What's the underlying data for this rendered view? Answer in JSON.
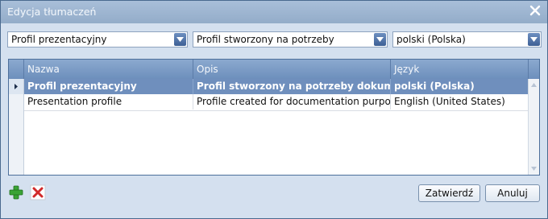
{
  "window": {
    "title": "Edycja tłumaczeń"
  },
  "filters": [
    {
      "value": "Profil prezentacyjny"
    },
    {
      "value": "Profil stworzony na potrzeby"
    },
    {
      "value": "polski (Polska)"
    }
  ],
  "grid": {
    "columns": [
      "Nazwa",
      "Opis",
      "Język"
    ],
    "rows": [
      {
        "name": "Profil prezentacyjny",
        "description": "Profil stworzony na potrzeby dokumentacji",
        "language": "polski (Polska)",
        "selected": true
      },
      {
        "name": "Presentation profile",
        "description": "Profile created for documentation purposes",
        "language": "English (United States)",
        "selected": false
      }
    ]
  },
  "buttons": {
    "confirm": "Zatwierdź",
    "cancel": "Anuluj"
  },
  "icons": {
    "add": "plus-icon",
    "delete": "delete-icon",
    "close": "close-icon"
  },
  "colors": {
    "title_bar": "#9fb7d4",
    "header": "#7b9bc6",
    "selected_row": "#6f8fbd",
    "add": "#3aa335",
    "delete": "#d12a2a"
  }
}
